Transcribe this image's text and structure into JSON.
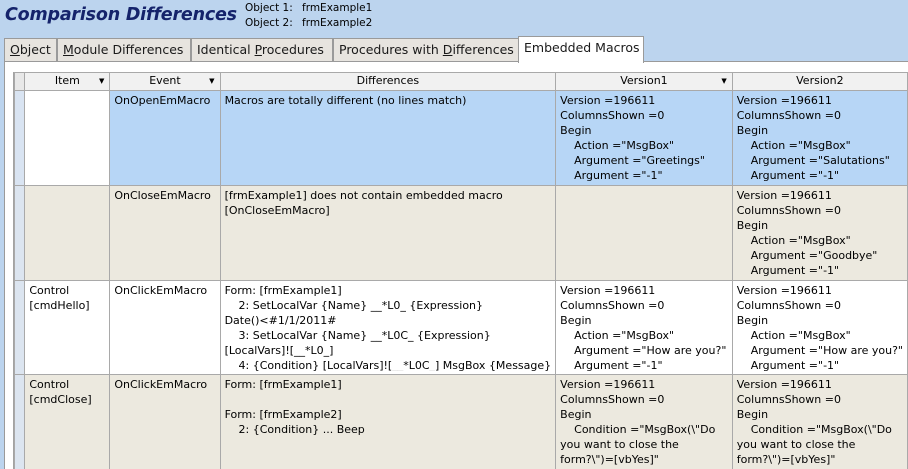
{
  "header": {
    "title": "Comparison Differences",
    "object1_label": "Object 1:",
    "object1_value": "frmExample1",
    "object2_label": "Object 2:",
    "object2_value": "frmExample2"
  },
  "tabs": [
    {
      "label": "Object",
      "active": false
    },
    {
      "label": "Module Differences",
      "active": false
    },
    {
      "label": "Identical Procedures",
      "active": false
    },
    {
      "label": "Procedures with Differences",
      "active": false
    },
    {
      "label": "Embedded Macros",
      "active": true
    }
  ],
  "grid": {
    "columns": [
      "Item",
      "Event",
      "Differences",
      "Version1",
      "Version2"
    ],
    "rows": [
      {
        "item": "",
        "event": "OnOpenEmMacro",
        "differences": "Macros are totally different (no lines match)",
        "version1": "Version =196611\nColumnsShown =0\nBegin\n    Action =\"MsgBox\"\n    Argument =\"Greetings\"\n    Argument =\"-1\"",
        "version2": "Version =196611\nColumnsShown =0\nBegin\n    Action =\"MsgBox\"\n    Argument =\"Salutations\"\n    Argument =\"-1\""
      },
      {
        "item": "",
        "event": "OnCloseEmMacro",
        "differences": "[frmExample1] does not contain embedded macro\n[OnCloseEmMacro]",
        "version1": "",
        "version2": "Version =196611\nColumnsShown =0\nBegin\n    Action =\"MsgBox\"\n    Argument =\"Goodbye\"\n    Argument =\"-1\""
      },
      {
        "item": "Control\n[cmdHello]",
        "event": "OnClickEmMacro",
        "differences": "Form: [frmExample1]\n    2: SetLocalVar {Name} __*L0_ {Expression}\nDate()<#1/1/2011#\n    3: SetLocalVar {Name} __*L0C_ {Expression}\n[LocalVars]![__*L0_]\n    4: {Condition} [LocalVars]![__*L0C_] MsgBox {Message}",
        "version1": "Version =196611\nColumnsShown =0\nBegin\n    Action =\"MsgBox\"\n    Argument =\"How are you?\"\n    Argument =\"-1\"",
        "version2": "Version =196611\nColumnsShown =0\nBegin\n    Action =\"MsgBox\"\n    Argument =\"How are you?\"\n    Argument =\"-1\""
      },
      {
        "item": "Control\n[cmdClose]",
        "event": "OnClickEmMacro",
        "differences": "Form: [frmExample1]\n\nForm: [frmExample2]\n    2: {Condition} ... Beep",
        "version1": "Version =196611\nColumnsShown =0\nBegin\n    Condition =\"MsgBox(\\\"Do\nyou want to close the\nform?\\\")=[vbYes]\"",
        "version2": "Version =196611\nColumnsShown =0\nBegin\n    Condition =\"MsgBox(\\\"Do\nyou want to close the\nform?\\\")=[vbYes]\""
      }
    ]
  }
}
